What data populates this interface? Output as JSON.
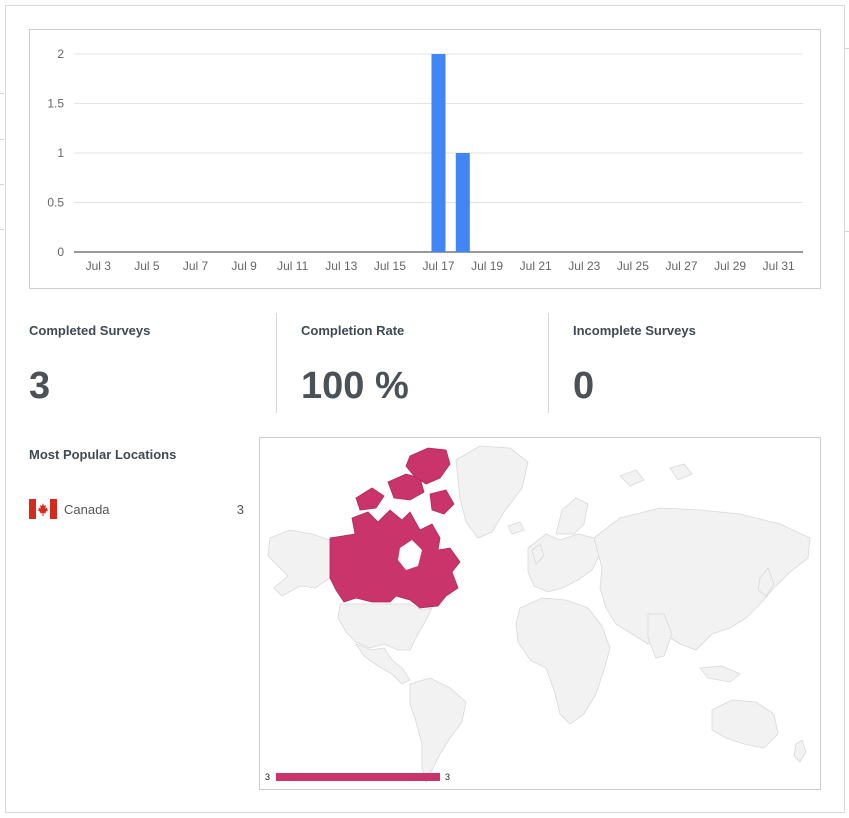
{
  "chart_data": {
    "type": "bar",
    "x_tick_labels": [
      "Jul 3",
      "Jul 5",
      "Jul 7",
      "Jul 9",
      "Jul 11",
      "Jul 13",
      "Jul 15",
      "Jul 17",
      "Jul 19",
      "Jul 21",
      "Jul 23",
      "Jul 25",
      "Jul 27",
      "Jul 29",
      "Jul 31"
    ],
    "y_tick_labels": [
      "0",
      "0.5",
      "1",
      "1.5",
      "2"
    ],
    "ylim": [
      0,
      2
    ],
    "xlim_days": [
      2,
      32
    ],
    "bars": [
      {
        "day": 17,
        "value": 2
      },
      {
        "day": 18,
        "value": 1
      }
    ],
    "grid": true,
    "bar_color": "#4285f4"
  },
  "stats": {
    "completed": {
      "label": "Completed Surveys",
      "value": "3"
    },
    "rate": {
      "label": "Completion Rate",
      "value": "100 %"
    },
    "incomplete": {
      "label": "Incomplete Surveys",
      "value": "0"
    }
  },
  "locations": {
    "title": "Most Popular Locations",
    "items": [
      {
        "country": "Canada",
        "count": "3",
        "flag": "canada-flag-icon"
      }
    ]
  },
  "map": {
    "highlight_country": "Canada",
    "highlight_color": "#c9356b",
    "base_color": "#f2f2f2",
    "legend_min": "3",
    "legend_max": "3"
  }
}
